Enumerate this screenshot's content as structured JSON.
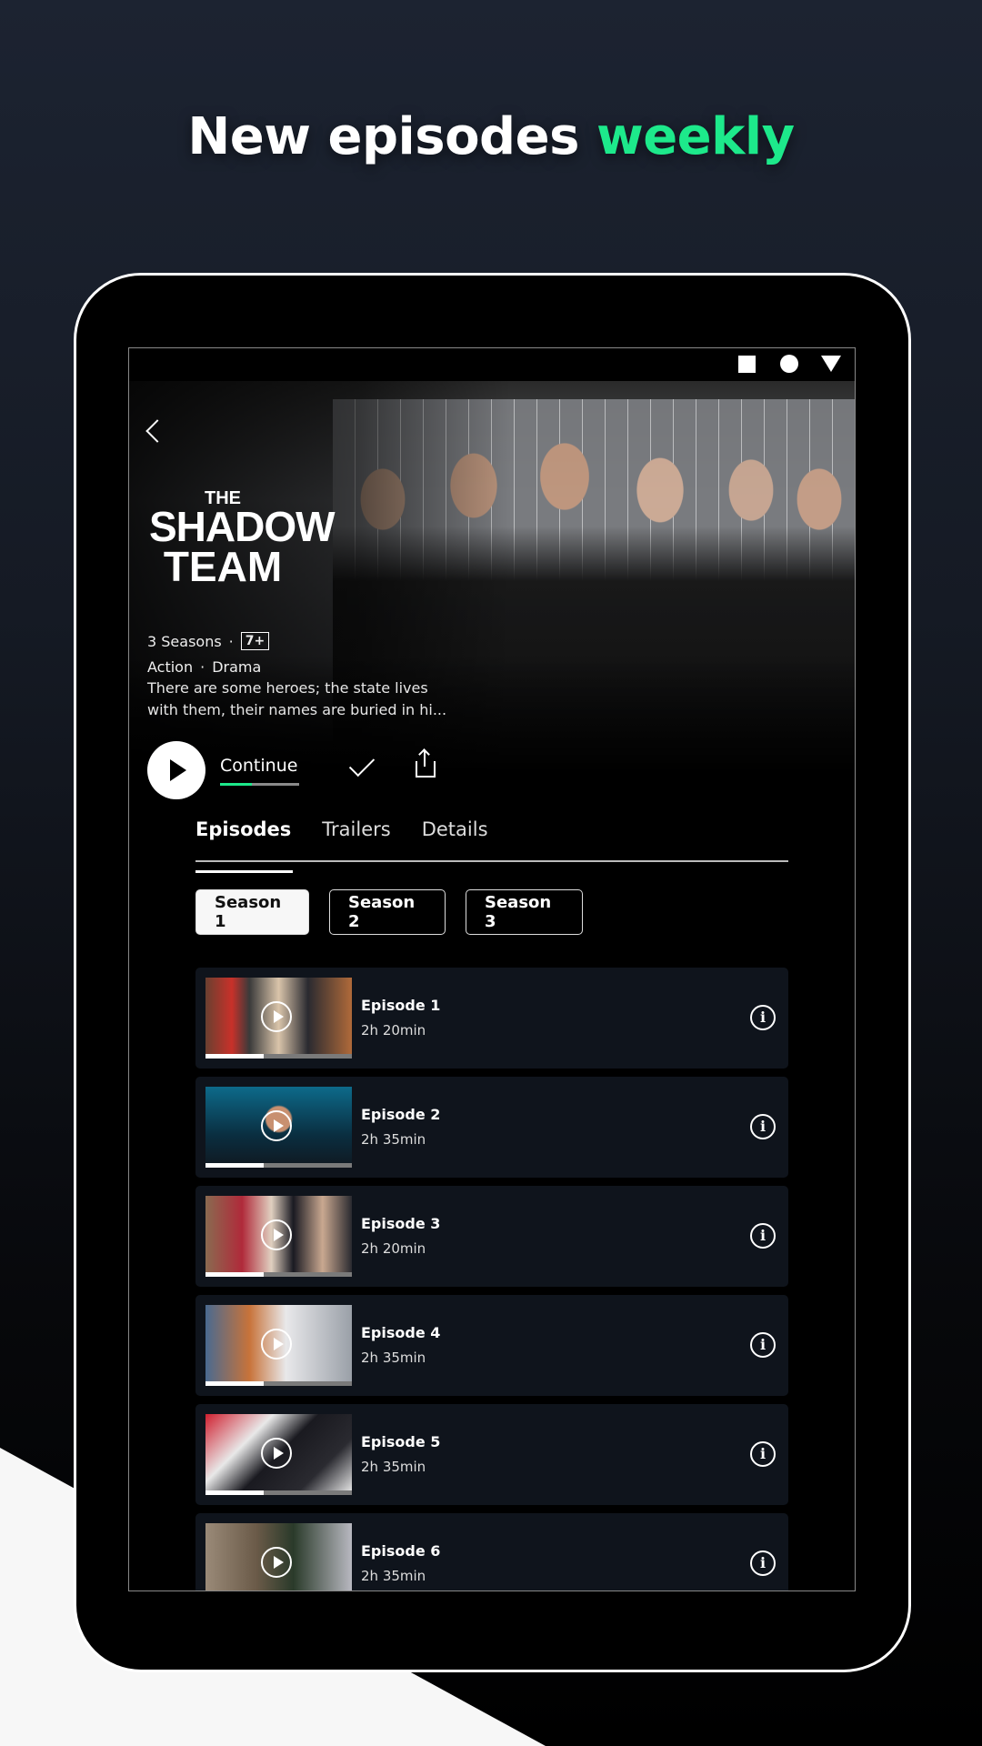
{
  "headline": {
    "prefix": "New episodes ",
    "accent": "weekly",
    "accent_color": "#1de98b"
  },
  "status_bar": {
    "icons": [
      "square-icon",
      "circle-icon",
      "triangle-icon"
    ]
  },
  "show": {
    "logo": {
      "line1": "THE",
      "line2": "SHADOW",
      "line3": "TEAM"
    },
    "seasons_count": "3 Seasons",
    "rating": "7+",
    "genres": [
      "Action",
      "Drama"
    ],
    "description": "There are some heroes; the state lives with them, their names are buried in hi...",
    "continue_label": "Continue",
    "continue_progress": 0.4
  },
  "tabs": [
    {
      "label": "Episodes",
      "active": true
    },
    {
      "label": "Trailers"
    },
    {
      "label": "Details"
    }
  ],
  "seasons": [
    {
      "label": "Season 1",
      "active": true
    },
    {
      "label": "Season 2"
    },
    {
      "label": "Season 3"
    }
  ],
  "episodes": [
    {
      "title": "Episode 1",
      "duration": "2h 20min",
      "progress": 0.4
    },
    {
      "title": "Episode 2",
      "duration": "2h 35min",
      "progress": 0.4
    },
    {
      "title": "Episode 3",
      "duration": "2h 20min",
      "progress": 0.4
    },
    {
      "title": "Episode 4",
      "duration": "2h 35min",
      "progress": 0.4
    },
    {
      "title": "Episode 5",
      "duration": "2h 35min",
      "progress": 0.4
    },
    {
      "title": "Episode 6",
      "duration": "2h 35min",
      "progress": 0.4
    }
  ],
  "info_glyph": "i"
}
